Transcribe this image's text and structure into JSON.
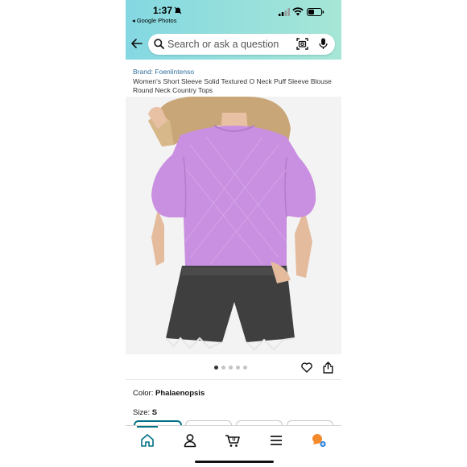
{
  "status_bar": {
    "time": "1:37",
    "back_app": "◂ Google Photos"
  },
  "search": {
    "placeholder": "Search or ask a question"
  },
  "product": {
    "brand": "Brand: Foenlintenso",
    "title": "Women's Short Sleeve Solid Textured O Neck Puff Sleeve Blouse Round Neck Country Tops",
    "image_count": 5,
    "active_image": 0,
    "color_label": "Color: ",
    "color_value": "Phalaenopsis",
    "size_label": "Size: ",
    "size_value": "S"
  },
  "colors": {
    "accent": "#007185",
    "header_gradient_start": "#84d8e2",
    "header_gradient_end": "#a6e6d6",
    "brand_link": "#2f6f9a",
    "blouse": "#c98fe0"
  },
  "bottom_nav": {
    "items": [
      "home-icon",
      "account-icon",
      "cart-icon",
      "menu-icon",
      "rufus-icon"
    ],
    "cart_count": "0"
  }
}
